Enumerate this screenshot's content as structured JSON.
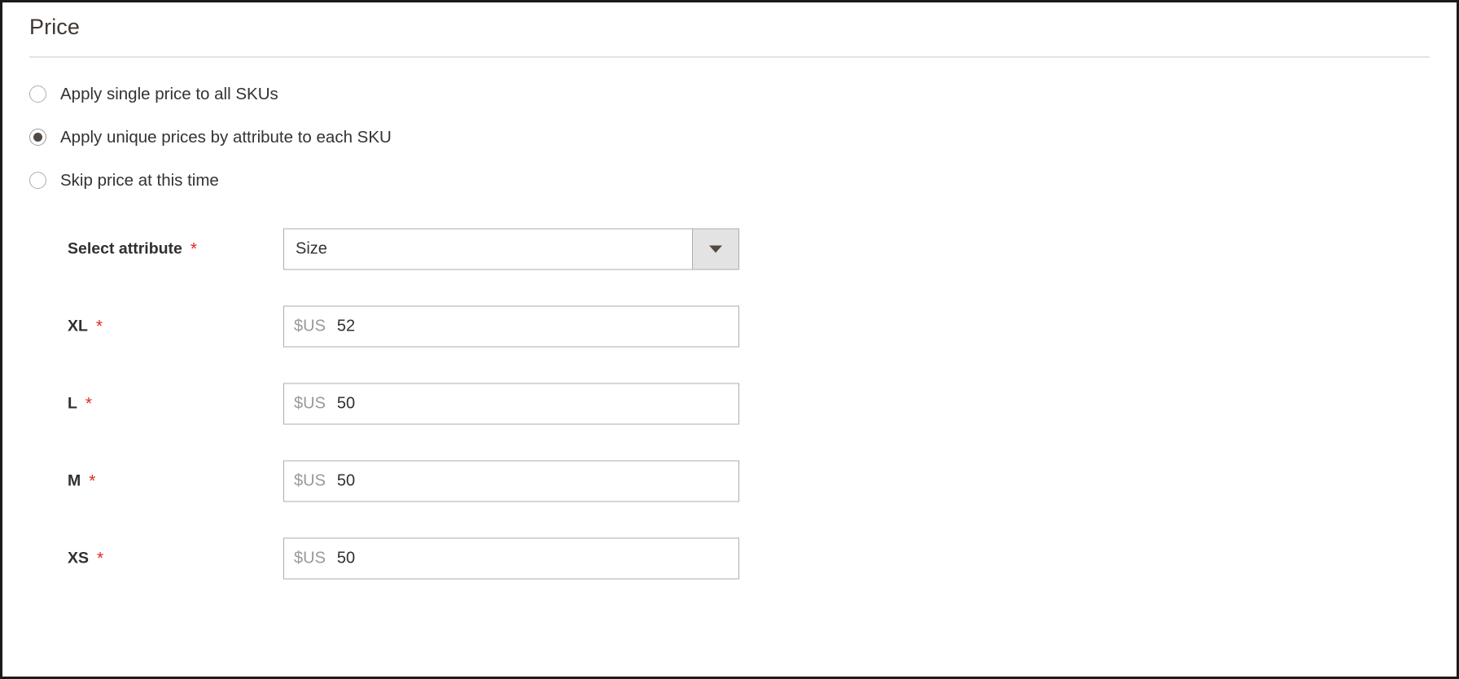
{
  "section": {
    "title": "Price"
  },
  "pricing_mode": {
    "options": [
      {
        "label": "Apply single price to all SKUs",
        "selected": false
      },
      {
        "label": "Apply unique prices by attribute to each SKU",
        "selected": true
      },
      {
        "label": "Skip price at this time",
        "selected": false
      }
    ]
  },
  "attribute_selector": {
    "label": "Select attribute",
    "required_marker": "*",
    "value": "Size",
    "caret_icon": "chevron-down-icon"
  },
  "price_rows": [
    {
      "label": "XL",
      "required_marker": "*",
      "currency": "$US",
      "value": "52"
    },
    {
      "label": "L",
      "required_marker": "*",
      "currency": "$US",
      "value": "50"
    },
    {
      "label": "M",
      "required_marker": "*",
      "currency": "$US",
      "value": "50"
    },
    {
      "label": "XS",
      "required_marker": "*",
      "currency": "$US",
      "value": "50"
    }
  ],
  "colors": {
    "required_star": "#e02b27",
    "selected_radio_dot": "#514943",
    "heading": "#41362f",
    "field_border": "#adadad",
    "dropdown_button_bg": "#e3e3e3"
  }
}
